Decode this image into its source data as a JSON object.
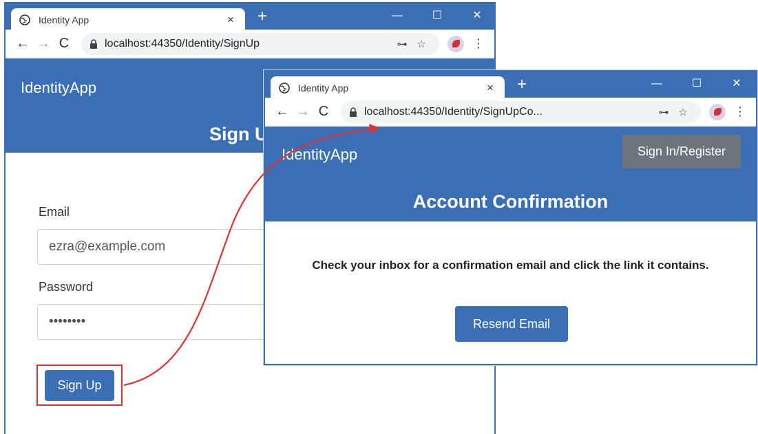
{
  "colors": {
    "accent": "#3b6fb5",
    "secondary": "#6c757d",
    "highlight": "#e03131"
  },
  "window_back": {
    "tab_title": "Identity App",
    "tab_close": "×",
    "new_tab": "+",
    "min": "—",
    "max": "☐",
    "close": "✕",
    "url": "localhost:44350/Identity/SignUp",
    "brand": "IdentityApp",
    "heading": "Sign Up",
    "form": {
      "email_label": "Email",
      "email_value": "ezra@example.com",
      "password_label": "Password",
      "password_value": "••••••••",
      "signup_button": "Sign Up"
    }
  },
  "window_front": {
    "tab_title": "Identity App",
    "tab_close": "×",
    "new_tab": "+",
    "min": "—",
    "max": "☐",
    "close": "✕",
    "url": "localhost:44350/Identity/SignUpCo...",
    "brand": "IdentityApp",
    "signin_button": "Sign In/Register",
    "heading": "Account Confirmation",
    "message": "Check your inbox for a confirmation email and click the link it contains.",
    "resend_button": "Resend Email"
  },
  "toolbar": {
    "back": "←",
    "forward": "→",
    "reload": "C",
    "key": "⊶",
    "star": "☆",
    "menu": "⋮"
  }
}
